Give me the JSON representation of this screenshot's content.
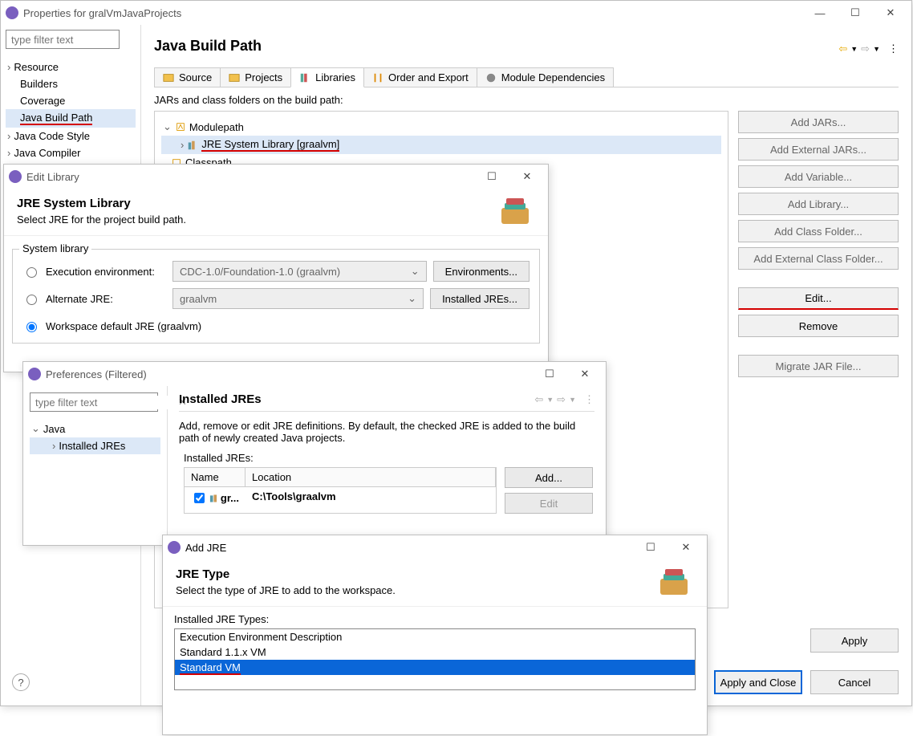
{
  "props": {
    "title": "Properties for gralVmJavaProjects",
    "filter_placeholder": "type filter text",
    "sidebar": [
      {
        "label": "Resource",
        "caret": true
      },
      {
        "label": "Builders"
      },
      {
        "label": "Coverage"
      },
      {
        "label": "Java Build Path",
        "selected": true,
        "underline": true
      },
      {
        "label": "Java Code Style",
        "caret": true
      },
      {
        "label": "Java Compiler",
        "caret": true
      }
    ],
    "page_title": "Java Build Path",
    "tabs": [
      {
        "label": "Source"
      },
      {
        "label": "Projects"
      },
      {
        "label": "Libraries",
        "active": true
      },
      {
        "label": "Order and Export"
      },
      {
        "label": "Module Dependencies"
      }
    ],
    "desc": "JARs and class folders on the build path:",
    "tree": {
      "modulepath": "Modulepath",
      "jre_lib": "JRE System Library [graalvm]",
      "classpath": "Classpath"
    },
    "buttons": [
      "Add JARs...",
      "Add External JARs...",
      "Add Variable...",
      "Add Library...",
      "Add Class Folder...",
      "Add External Class Folder..."
    ],
    "edit": "Edit...",
    "remove": "Remove",
    "migrate": "Migrate JAR File...",
    "apply": "Apply",
    "apply_close": "Apply and Close",
    "cancel": "Cancel"
  },
  "editlib": {
    "title": "Edit Library",
    "hdr_title": "JRE System Library",
    "hdr_sub": "Select JRE for the project build path.",
    "group_label": "System library",
    "row1_label": "Execution environment:",
    "row1_combo": "CDC-1.0/Foundation-1.0 (graalvm)",
    "row1_btn": "Environments...",
    "row2_label": "Alternate JRE:",
    "row2_combo": "graalvm",
    "row2_btn": "Installed JREs...",
    "row3_label": "Workspace default JRE (graalvm)"
  },
  "prefs": {
    "title": "Preferences (Filtered)",
    "filter_placeholder": "type filter text",
    "tree_java": "Java",
    "tree_jres": "Installed JREs",
    "hdr_title": "Installed JREs",
    "desc": "Add, remove or edit JRE definitions. By default, the checked JRE is added to the build path of newly created Java projects.",
    "table_label": "Installed JREs:",
    "col_name": "Name",
    "col_loc": "Location",
    "row_name": "gr...",
    "row_loc": "C:\\Tools\\graalvm",
    "btn_add": "Add...",
    "btn_edit": "Edit"
  },
  "addjre": {
    "title": "Add JRE",
    "hdr_title": "JRE Type",
    "hdr_sub": "Select the type of JRE to add to the workspace.",
    "list_label": "Installed JRE Types:",
    "list": [
      "Execution Environment Description",
      "Standard 1.1.x VM",
      "Standard VM"
    ]
  }
}
